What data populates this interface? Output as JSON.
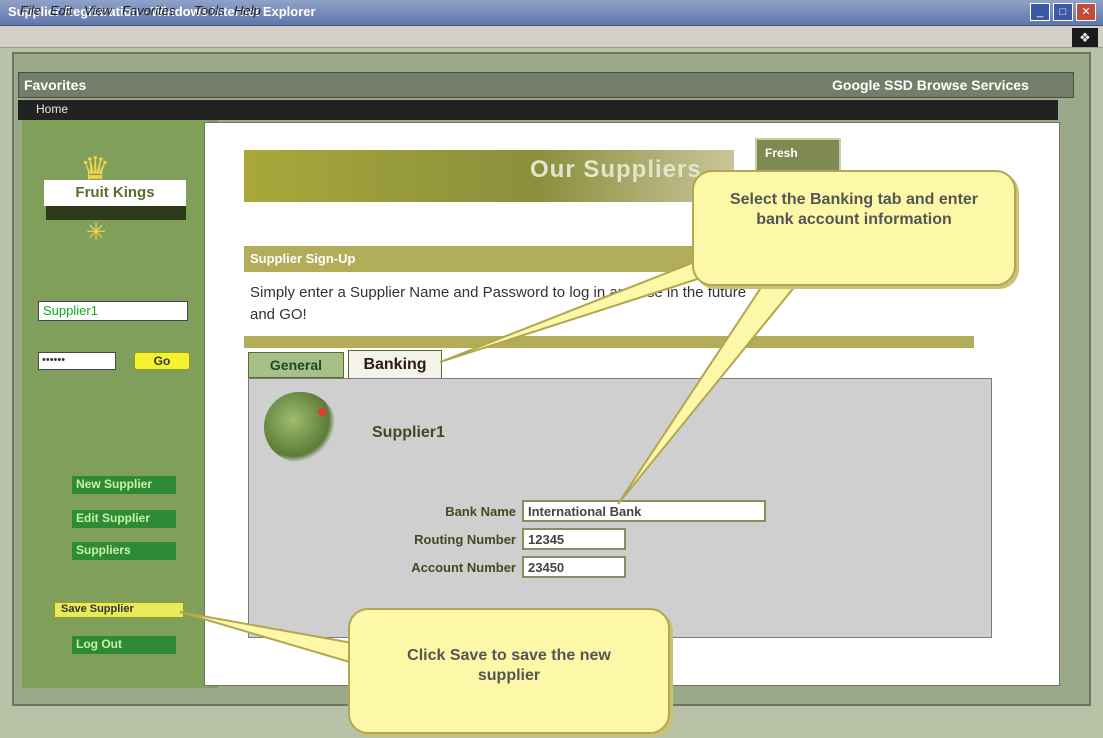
{
  "window": {
    "title": "Supplier Registration - Windows Internet Explorer",
    "controls": [
      "_",
      "□",
      "✕"
    ]
  },
  "menu": [
    "File",
    "Edit",
    "View",
    "Favorites",
    "Tools",
    "Help"
  ],
  "favorites_bar": {
    "label": "Favorites",
    "search": "Google SSD Browse Services"
  },
  "browser_tab": "Home",
  "sidebar": {
    "logo_text": "Fruit Kings",
    "supplier_name": "Supplier1",
    "password_value": "••••••",
    "go_label": "Go",
    "links": [
      "New Supplier",
      "Edit Supplier",
      "Suppliers"
    ],
    "save_label": "Save Supplier",
    "bottom_link": "Log Out"
  },
  "main": {
    "banner_title": "Our Suppliers",
    "banner_icon_label": "Fresh",
    "subbar_label": "Supplier Sign-Up",
    "instructions": "Simply enter a Supplier Name and Password to log in and use in the future and GO!",
    "tabs": [
      {
        "label": "General",
        "active": false
      },
      {
        "label": "Banking",
        "active": true
      }
    ],
    "panel": {
      "supplier_name": "Supplier1",
      "fields": [
        {
          "label": "Bank Name",
          "value": "International Bank"
        },
        {
          "label": "Routing Number",
          "value": "12345"
        },
        {
          "label": "Account Number",
          "value": "23450"
        }
      ]
    }
  },
  "callouts": {
    "banking": "Select the Banking tab and enter bank account information",
    "save": "Click Save to save the new supplier"
  }
}
